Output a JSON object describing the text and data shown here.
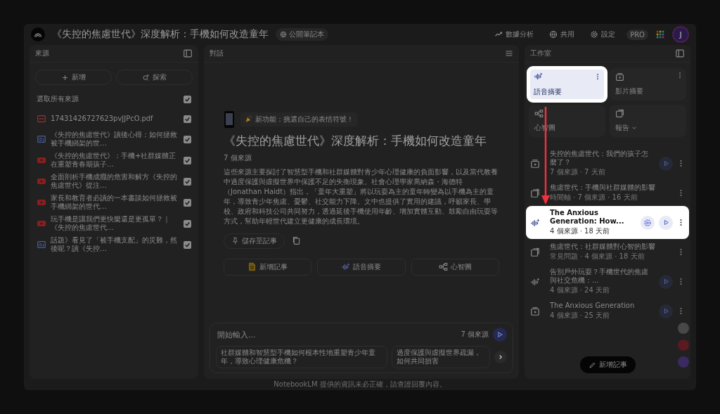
{
  "header": {
    "title": "《失控的焦慮世代》深度解析：手機如何改造童年",
    "badge": "公開筆記本",
    "actions": [
      {
        "kind": "chart",
        "label": "數據分析"
      },
      {
        "kind": "globe",
        "label": "共用"
      },
      {
        "kind": "gear",
        "label": "設定"
      }
    ],
    "plan": "PRO",
    "avatar": "J"
  },
  "sources": {
    "title": "來源",
    "add": "新增",
    "explore": "探索",
    "select_all": {
      "label": "選取所有來源",
      "checked": true
    },
    "items": [
      {
        "kind": "pdf",
        "title": "17431426727623pvJJPcO.pdf",
        "checked": true
      },
      {
        "kind": "doc",
        "title": "《失控的焦慮世代》讀後心得：如何拯救被手機綁架的世…",
        "checked": true
      },
      {
        "kind": "video",
        "title": "《失控的焦慮世代》：手機+社群媒體正在重塑青春期孩子…",
        "checked": true
      },
      {
        "kind": "video",
        "title": "全面剖析手機成癮的危害和解方《失控的焦慮世代》從注…",
        "checked": true
      },
      {
        "kind": "video",
        "title": "家長和教育者必讀的一本書談如何拯救被手機綁架的世代…",
        "checked": true
      },
      {
        "kind": "video",
        "title": "玩手機是讓我們更快樂還是更孤單？｜《失控的焦慮世代…",
        "checked": true
      },
      {
        "kind": "doc",
        "title": "話題》看見了「被手機支配」的災難，然後呢？讀《失控…",
        "checked": true
      }
    ]
  },
  "chat": {
    "title": "對話",
    "announcement": "新功能：挑選自己的表情符號！",
    "notebook_title": "《失控的焦慮世代》深度解析：手機如何改造童年",
    "source_count": "7 個來源",
    "summary": "這些來源主要探討了智慧型手機和社群媒體對青少年心理健康的負面影響，以及當代教養中過度保護與虛擬世界中保護不足的失衡現象。社會心理學家喬納森・海德特（Jonathan Haidt）指出，「童年大重塑」將以玩耍為主的童年轉變為以手機為主的童年，導致青少年焦慮、憂鬱、社交能力下降。文中也提供了實用的建議，呼籲家長、學校、政府和科技公司共同努力，透過延後手機使用年齡、增加實體互動、鼓勵自由玩耍等方式，幫助年輕世代建立更健康的成長環境。",
    "save": "儲存至記事",
    "actions": [
      {
        "kind": "note",
        "label": "新增記事"
      },
      {
        "kind": "audio",
        "label": "語音摘要"
      },
      {
        "kind": "mindmap",
        "label": "心智圖"
      }
    ],
    "input": {
      "placeholder": "開始輸入...",
      "source_count": "7 個來源"
    },
    "suggestions": [
      "社群媒體和智慧型手機如何根本性地重塑青少年童年，導致心理健康危機？",
      "過度保護與虛擬世界疏漏，如何共同損害"
    ]
  },
  "studio": {
    "title": "工作室",
    "tiles": [
      {
        "kind": "audio",
        "label": "語音摘要",
        "dropdown": false,
        "highlighted": true
      },
      {
        "kind": "video",
        "label": "影片摘要",
        "dropdown": false,
        "highlighted": false
      },
      {
        "kind": "mindmap",
        "label": "心智圖",
        "dropdown": false,
        "highlighted": false
      },
      {
        "kind": "report",
        "label": "報告",
        "dropdown": true,
        "highlighted": false
      }
    ],
    "outputs": [
      {
        "kind": "video",
        "title": "失控的焦慮世代：我們的孩子怎麼了？",
        "meta": "7 個來源 · 7 天前",
        "playable": true,
        "interactive": false,
        "highlighted": false
      },
      {
        "kind": "report",
        "title": "焦慮世代：手機與社群媒體的影響",
        "meta": "時間軸 · 7 個來源 · 16 天前",
        "playable": false,
        "interactive": false,
        "highlighted": false
      },
      {
        "kind": "audio",
        "title": "The Anxious Generation: How...",
        "meta": "4 個來源 · 18 天前",
        "playable": true,
        "interactive": true,
        "highlighted": true
      },
      {
        "kind": "report",
        "title": "焦慮世代：社群媒體對心智的影響",
        "meta": "常見問題 · 4 個來源 · 18 天前",
        "playable": false,
        "interactive": false,
        "highlighted": false
      },
      {
        "kind": "audio",
        "title": "告別戶外玩耍？手機世代的焦慮與社交危機：...",
        "meta": "4 個來源 · 24 天前",
        "playable": true,
        "interactive": false,
        "highlighted": false
      },
      {
        "kind": "video",
        "title": "The Anxious Generation",
        "meta": "4 個來源 · 25 天前",
        "playable": true,
        "interactive": false,
        "highlighted": false
      }
    ],
    "add_note": "新增記事"
  },
  "footer": "NotebookLM 提供的資訊未必正確，請查證回覆內容。"
}
